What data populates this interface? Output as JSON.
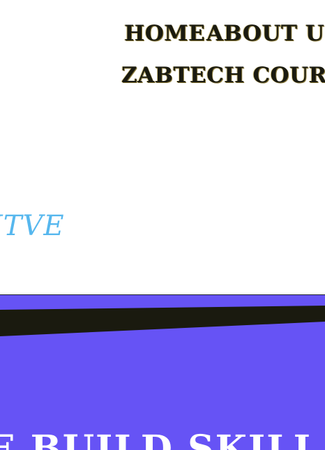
{
  "nav": {
    "items": [
      {
        "label": "HOME"
      },
      {
        "label": "ABOUT US"
      },
      {
        "label": "ZABTECH COURSES"
      }
    ]
  },
  "hero": {
    "word": "ITVE"
  },
  "band": {
    "text": "E BUILD SKILL",
    "background_color": "#6653f5",
    "stripe_color": "#1a1a0f"
  },
  "colors": {
    "nav_text": "#1a1a10",
    "hero_word": "#56b7ee",
    "page_background": "#ffffff"
  }
}
